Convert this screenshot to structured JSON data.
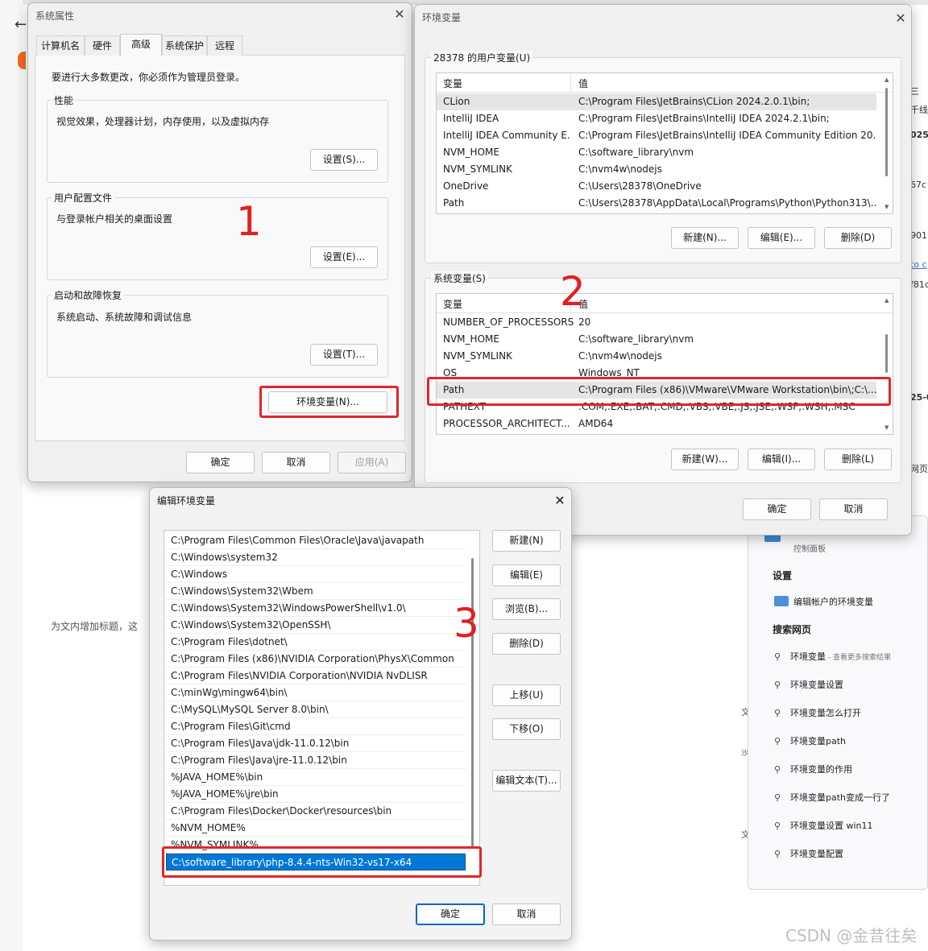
{
  "background": {
    "article_text": "为文内增加标题，这",
    "right_fragments": [
      "三",
      "千线",
      "025",
      "67c",
      "901",
      "to c",
      "f81c",
      "25-0",
      "网页"
    ],
    "mid_fragments": [
      "文",
      "沙",
      "文"
    ],
    "watermark": "CSDN @金昔往矣"
  },
  "search_panel": {
    "top_app_label": "控制面板",
    "settings_heading": "设置",
    "setting_item": "编辑帐户的环境变量",
    "web_heading": "搜索网页",
    "web_items": [
      {
        "text": "环境变量",
        "sub": " - 查看更多搜索结果"
      },
      {
        "text": "环境变量设置",
        "sub": ""
      },
      {
        "text": "环境变量怎么打开",
        "sub": ""
      },
      {
        "text": "环境变量path",
        "sub": ""
      },
      {
        "text": "环境变量的作用",
        "sub": ""
      },
      {
        "text": "环境变量path变成一行了",
        "sub": ""
      },
      {
        "text": "环境变量设置 win11",
        "sub": ""
      },
      {
        "text": "环境变量配置",
        "sub": ""
      }
    ],
    "search_icon": "search-icon"
  },
  "sysprops": {
    "title": "系统属性",
    "tabs": [
      "计算机名",
      "硬件",
      "高级",
      "系统保护",
      "远程"
    ],
    "admin_note": "要进行大多数更改，你必须作为管理员登录。",
    "groups": [
      {
        "label": "性能",
        "desc": "视觉效果，处理器计划，内存使用，以及虚拟内存",
        "button": "设置(S)..."
      },
      {
        "label": "用户配置文件",
        "desc": "与登录帐户相关的桌面设置",
        "button": "设置(E)..."
      },
      {
        "label": "启动和故障恢复",
        "desc": "系统启动、系统故障和调试信息",
        "button": "设置(T)..."
      }
    ],
    "env_button": "环境变量(N)...",
    "ok": "确定",
    "cancel": "取消",
    "apply": "应用(A)"
  },
  "envvars": {
    "title": "环境变量",
    "user_group_label": "28378 的用户变量(U)",
    "col_var": "变量",
    "col_val": "值",
    "user_rows": [
      {
        "name": "CLion",
        "value": "C:\\Program Files\\JetBrains\\CLion 2024.2.0.1\\bin;"
      },
      {
        "name": "IntelliJ IDEA",
        "value": "C:\\Program Files\\JetBrains\\IntelliJ IDEA 2024.2.1\\bin;"
      },
      {
        "name": "IntelliJ IDEA Community E...",
        "value": "C:\\Program Files\\JetBrains\\IntelliJ IDEA Community Edition 20..."
      },
      {
        "name": "NVM_HOME",
        "value": "C:\\software_library\\nvm"
      },
      {
        "name": "NVM_SYMLINK",
        "value": "C:\\nvm4w\\nodejs"
      },
      {
        "name": "OneDrive",
        "value": "C:\\Users\\28378\\OneDrive"
      },
      {
        "name": "Path",
        "value": "C:\\Users\\28378\\AppData\\Local\\Programs\\Python\\Python313\\..."
      }
    ],
    "user_buttons": [
      "新建(N)...",
      "编辑(E)...",
      "删除(D)"
    ],
    "sys_group_label": "系统变量(S)",
    "sys_rows": [
      {
        "name": "NUMBER_OF_PROCESSORS",
        "value": "20"
      },
      {
        "name": "NVM_HOME",
        "value": "C:\\software_library\\nvm"
      },
      {
        "name": "NVM_SYMLINK",
        "value": "C:\\nvm4w\\nodejs"
      },
      {
        "name": "OS",
        "value": "Windows_NT"
      },
      {
        "name": "Path",
        "value": "C:\\Program Files (x86)\\VMware\\VMware Workstation\\bin\\;C:\\..."
      },
      {
        "name": "PATHEXT",
        "value": ".COM;.EXE;.BAT;.CMD;.VBS;.VBE;.JS;.JSE;.WSF;.WSH;.MSC"
      },
      {
        "name": "PROCESSOR_ARCHITECT...",
        "value": "AMD64"
      }
    ],
    "sys_buttons": [
      "新建(W)...",
      "编辑(I)...",
      "删除(L)"
    ],
    "ok": "确定",
    "cancel": "取消"
  },
  "editvar": {
    "title": "编辑环境变量",
    "paths": [
      "C:\\Program Files\\Common Files\\Oracle\\Java\\javapath",
      "C:\\Windows\\system32",
      "C:\\Windows",
      "C:\\Windows\\System32\\Wbem",
      "C:\\Windows\\System32\\WindowsPowerShell\\v1.0\\",
      "C:\\Windows\\System32\\OpenSSH\\",
      "C:\\Program Files\\dotnet\\",
      "C:\\Program Files (x86)\\NVIDIA Corporation\\PhysX\\Common",
      "C:\\Program Files\\NVIDIA Corporation\\NVIDIA NvDLISR",
      "C:\\minWg\\mingw64\\bin\\",
      "C:\\MySQL\\MySQL Server 8.0\\bin\\",
      "C:\\Program Files\\Git\\cmd",
      "C:\\Program Files\\Java\\jdk-11.0.12\\bin",
      "C:\\Program Files\\Java\\jre-11.0.12\\bin",
      "%JAVA_HOME%\\bin",
      "%JAVA_HOME%\\jre\\bin",
      "C:\\Program Files\\Docker\\Docker\\resources\\bin",
      "%NVM_HOME%",
      "%NVM_SYMLINK%",
      "C:\\software_library\\php-8.4.4-nts-Win32-vs17-x64"
    ],
    "buttons": [
      "新建(N)",
      "编辑(E)",
      "浏览(B)...",
      "删除(D)",
      "上移(U)",
      "下移(O)",
      "编辑文本(T)..."
    ],
    "ok": "确定",
    "cancel": "取消"
  },
  "annotations": [
    "1",
    "2",
    "3"
  ],
  "colors": {
    "annotation_red": "#e0262c",
    "selection_blue": "#0078d7"
  }
}
